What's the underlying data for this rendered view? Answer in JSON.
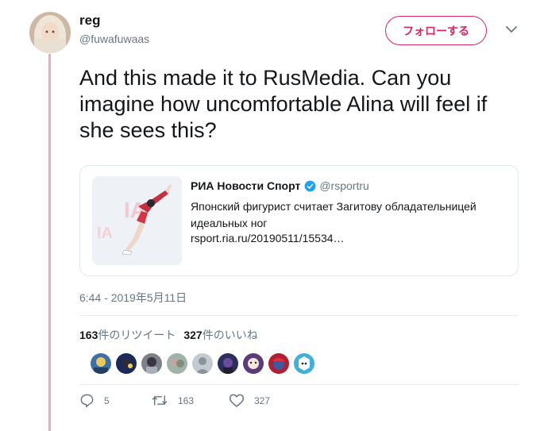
{
  "author": {
    "display_name": "reg",
    "handle": "@fuwafuwaas"
  },
  "follow_label": "フォローする",
  "tweet": {
    "text": "And this made it to RusMedia. Can you imagine how uncomfortable Alina will feel if she sees this?"
  },
  "card": {
    "source_name": "РИА Новости Спорт",
    "source_handle": "@rsportru",
    "description": "Японский фигурист считает Загитову обладательницей идеальных ног",
    "url": "rsport.ria.ru/20190511/15534…"
  },
  "timestamp": "6:44 - 2019年5月11日",
  "stats": {
    "retweet_count": "163",
    "retweet_label": "件のリツイート",
    "like_count": "327",
    "like_label": "件のいいね"
  },
  "actions": {
    "replies": "5",
    "retweets": "163",
    "likes": "327"
  },
  "colors": {
    "accent": "#e0245e",
    "thread_line": "#f0a9c4",
    "secondary_text": "#657786",
    "verified": "#1da1f2"
  },
  "icons": [
    "chevron-down-icon",
    "verified-badge-icon",
    "reply-icon",
    "retweet-icon",
    "heart-icon"
  ]
}
